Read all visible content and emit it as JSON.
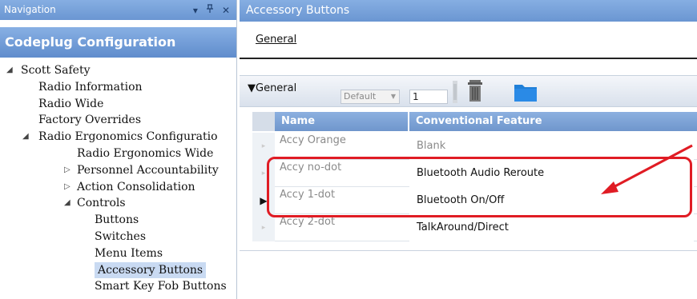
{
  "navigation": {
    "title": "Navigation",
    "controls": [
      "dropdown-icon",
      "pin-icon",
      "close-icon"
    ],
    "section_title": "Codeplug Configuration",
    "tree": [
      {
        "label": "Scott Safety",
        "toggle": "◢",
        "level": 0,
        "name": "tree-item-scott-safety"
      },
      {
        "label": "Radio Information",
        "toggle": "",
        "level": 1,
        "name": "tree-item-radio-information"
      },
      {
        "label": "Radio Wide",
        "toggle": "",
        "level": 1,
        "name": "tree-item-radio-wide"
      },
      {
        "label": "Factory Overrides",
        "toggle": "",
        "level": 1,
        "name": "tree-item-factory-overrides"
      },
      {
        "label": "Radio Ergonomics Configuratio",
        "toggle": "◢",
        "level": 1,
        "name": "tree-item-radio-ergonomics-configuration"
      },
      {
        "label": "Radio Ergonomics Wide",
        "toggle": "",
        "level": 2,
        "name": "tree-item-radio-ergonomics-wide"
      },
      {
        "label": "Personnel Accountability",
        "toggle": "▷",
        "level": 2,
        "name": "tree-item-personnel-accountability"
      },
      {
        "label": "Action Consolidation",
        "toggle": "▷",
        "level": 2,
        "name": "tree-item-action-consolidation"
      },
      {
        "label": "Controls",
        "toggle": "◢",
        "level": 2,
        "name": "tree-item-controls"
      },
      {
        "label": "Buttons",
        "toggle": "",
        "level": 3,
        "name": "tree-item-buttons"
      },
      {
        "label": "Switches",
        "toggle": "",
        "level": 3,
        "name": "tree-item-switches"
      },
      {
        "label": "Menu Items",
        "toggle": "",
        "level": 3,
        "name": "tree-item-menu-items"
      },
      {
        "label": "Accessory Buttons",
        "toggle": "",
        "level": 3,
        "name": "tree-item-accessory-buttons",
        "selected": true
      },
      {
        "label": "Smart Key Fob Buttons",
        "toggle": "",
        "level": 3,
        "name": "tree-item-smart-key-fob-buttons"
      }
    ]
  },
  "content": {
    "title": "Accessory Buttons",
    "tab_general": "General",
    "group": {
      "title": "▼General",
      "default_select": "Default",
      "number_value": "1"
    },
    "columns": [
      "Name",
      "Conventional Feature"
    ],
    "rows": [
      {
        "name": "Accy Orange",
        "feature": "Blank",
        "indicator": "▸",
        "current": false,
        "feature_dim": true
      },
      {
        "name": "Accy no-dot",
        "feature": "Bluetooth Audio Reroute",
        "indicator": "▸",
        "current": false,
        "feature_dim": false
      },
      {
        "name": "Accy 1-dot",
        "feature": "Bluetooth On/Off",
        "indicator": "▶",
        "current": true,
        "feature_dim": false
      },
      {
        "name": "Accy 2-dot",
        "feature": "TalkAround/Direct",
        "indicator": "▸",
        "current": false,
        "feature_dim": false
      }
    ]
  },
  "annotation": {
    "highlight_color": "#e01c24"
  },
  "colors": {
    "titlebar": "#6a96d2",
    "header": "#6f96cc",
    "selection": "#c9daf2"
  }
}
